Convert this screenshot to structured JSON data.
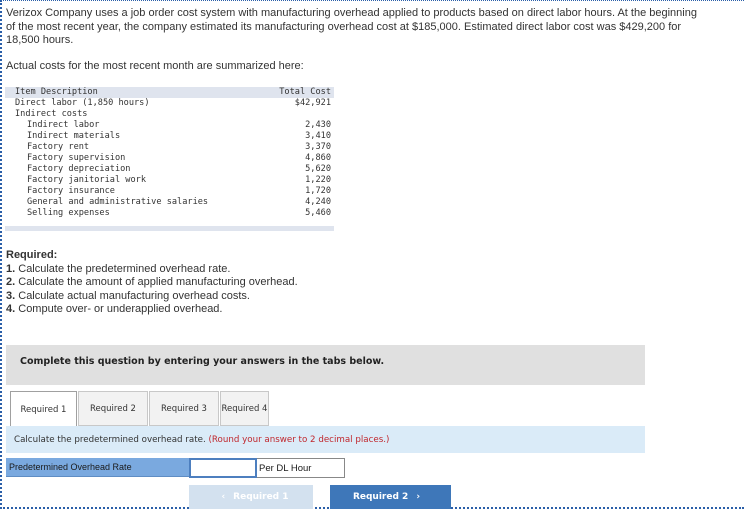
{
  "problem": {
    "intro": "Verizox Company uses a job order cost system with manufacturing overhead applied to products based on direct labor hours. At the beginning of the most recent year, the company estimated its manufacturing overhead cost at $185,000. Estimated direct labor cost was $429,200 for 18,500 hours.",
    "actual_costs_lead": "Actual costs for the most recent month are summarized here:"
  },
  "cost_table": {
    "headers": {
      "description": "Item Description",
      "total": "Total Cost"
    },
    "direct_labor": {
      "description": "Direct labor (1,850 hours)",
      "total": "$42,921"
    },
    "indirect_heading": "Indirect costs",
    "indirect_items": [
      {
        "description": "Indirect labor",
        "total": "2,430"
      },
      {
        "description": "Indirect materials",
        "total": "3,410"
      },
      {
        "description": "Factory rent",
        "total": "3,370"
      },
      {
        "description": "Factory supervision",
        "total": "4,860"
      },
      {
        "description": "Factory depreciation",
        "total": "5,620"
      },
      {
        "description": "Factory janitorial work",
        "total": "1,220"
      },
      {
        "description": "Factory insurance",
        "total": "1,720"
      },
      {
        "description": "General and administrative salaries",
        "total": "4,240"
      },
      {
        "description": "Selling expenses",
        "total": "5,460"
      }
    ]
  },
  "required": {
    "title": "Required:",
    "items": [
      {
        "num": "1.",
        "text": " Calculate the predetermined overhead rate."
      },
      {
        "num": "2.",
        "text": " Calculate the amount of applied manufacturing overhead."
      },
      {
        "num": "3.",
        "text": " Calculate actual manufacturing overhead costs."
      },
      {
        "num": "4.",
        "text": " Compute over- or underapplied overhead."
      }
    ]
  },
  "instructions_box": "Complete this question by entering your answers in the tabs below.",
  "tabs": [
    {
      "label": "Required 1",
      "active": true
    },
    {
      "label": "Required 2",
      "active": false
    },
    {
      "label": "Required 3",
      "active": false
    },
    {
      "label": "Required 4",
      "active": false
    }
  ],
  "task": {
    "text": "Calculate the predetermined overhead rate. ",
    "note": "(Round your answer to 2 decimal places.)"
  },
  "answer": {
    "label": "Predetermined Overhead Rate",
    "value": "",
    "unit": "Per DL Hour"
  },
  "nav": {
    "prev_label": "Required 1",
    "next_label": "Required 2",
    "prev_icon": "‹",
    "next_icon": "›",
    "prev_enabled": false
  },
  "colors": {
    "accent": "#3e77b9",
    "note_red": "#c0272d",
    "label_blue": "#7aa9df",
    "instr_bg": "#daebf8",
    "gray_box": "#e0e0e0"
  }
}
